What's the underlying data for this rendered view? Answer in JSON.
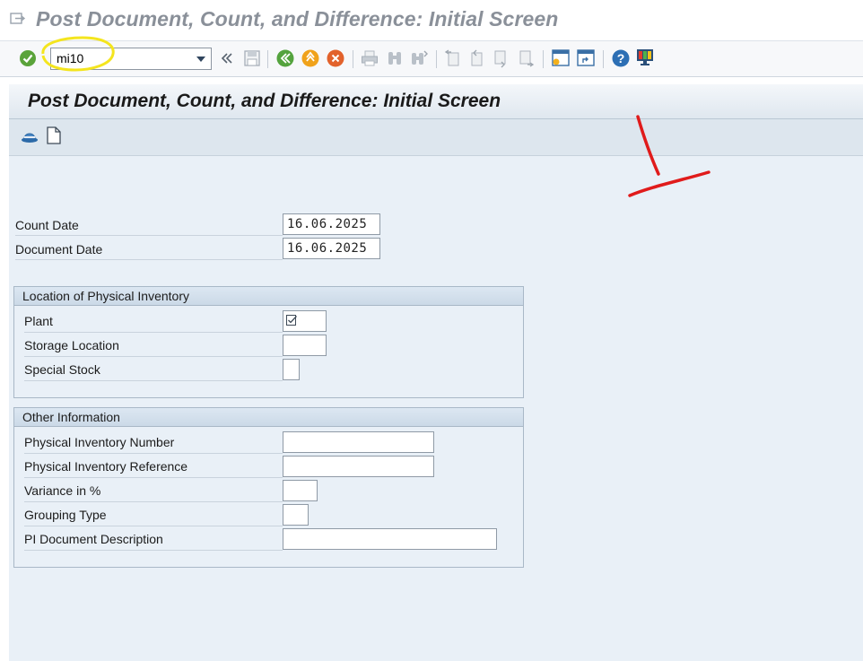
{
  "window": {
    "title": "Post Document, Count, and Difference: Initial Screen"
  },
  "toolbar": {
    "command_value": "mi10",
    "icons": [
      "enter-icon",
      "back-double-icon",
      "save-icon",
      "back-icon",
      "exit-icon",
      "cancel-icon",
      "print-icon",
      "find-icon",
      "find-next-icon",
      "first-page-icon",
      "previous-page-icon",
      "next-page-icon",
      "last-page-icon",
      "create-session-icon",
      "shortcut-icon",
      "help-icon",
      "customize-layout-icon"
    ]
  },
  "page": {
    "title": "Post Document, Count, and Difference: Initial Screen",
    "app_toolbar_icons": [
      "hat-icon",
      "document-icon"
    ]
  },
  "dates": {
    "count_date_label": "Count Date",
    "count_date_value": "16.06.2025",
    "document_date_label": "Document Date",
    "document_date_value": "16.06.2025"
  },
  "location_group": {
    "title": "Location of Physical Inventory",
    "plant_label": "Plant",
    "plant_value": "",
    "storage_location_label": "Storage Location",
    "storage_location_value": "",
    "special_stock_label": "Special Stock",
    "special_stock_value": ""
  },
  "other_group": {
    "title": "Other Information",
    "pi_number_label": "Physical Inventory Number",
    "pi_reference_label": "Physical Inventory Reference",
    "variance_label": "Variance in %",
    "grouping_type_label": "Grouping Type",
    "pi_description_label": "PI Document Description"
  },
  "colors": {
    "highlight_circle": "#f4e51e",
    "annotation_mark": "#e01b1b",
    "content_background": "#e9f0f7"
  }
}
